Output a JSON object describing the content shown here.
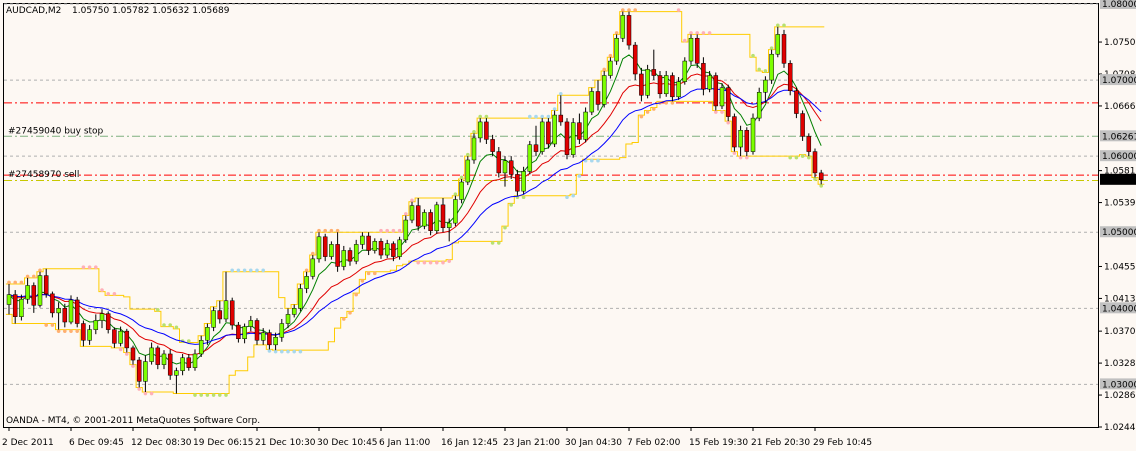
{
  "header": {
    "symbol": "AUDCAD,M2",
    "ohlc": "1.05750 1.05782 1.05632 1.05689"
  },
  "footer": {
    "copyright": "OANDA - MT4, © 2001-2011 MetaQuotes Software Corp."
  },
  "colors": {
    "background": "#fdf8f3",
    "bull": "#7cff00",
    "bear": "#e00000",
    "ma_fast": "#008000",
    "ma_mid": "#e00000",
    "ma_slow": "#0000ff",
    "channel": "#ffcc00",
    "orders": "#ff0000",
    "grid": "#b0b0b0",
    "price_tag": "#000000"
  },
  "chart_data": {
    "type": "candlestick",
    "ylim": [
      1.0244,
      1.08
    ],
    "x_ticks": [
      "2 Dec 2011",
      "6 Dec 09:45",
      "12 Dec 08:30",
      "19 Dec 06:15",
      "21 Dec 10:30",
      "30 Dec 10:45",
      "6 Jan 11:00",
      "16 Jan 12:45",
      "23 Jan 21:00",
      "30 Jan 04:30",
      "7 Feb 02:00",
      "15 Feb 19:30",
      "21 Feb 20:30",
      "29 Feb 10:45"
    ],
    "x_tick_index": [
      0,
      10,
      20,
      30,
      40,
      50,
      60,
      70,
      80,
      90,
      100,
      110,
      120,
      130
    ],
    "y_ticks": [
      "1.07500",
      "1.07080",
      "1.06660",
      "1.05810",
      "1.05390",
      "1.04550",
      "1.04130",
      "1.03700",
      "1.03280",
      "1.02860",
      "1.02440"
    ],
    "level_tags": [
      "1.08000",
      "1.07000",
      "1.06261",
      "1.06000",
      "1.05000",
      "1.04000",
      "1.03000"
    ],
    "last_price": "1.05689",
    "orders": [
      {
        "label": "#27459040 buy stop",
        "price": 1.06261
      },
      {
        "label": "#27458970 sell",
        "price": 1.05689
      }
    ],
    "horizontal_lines": [
      {
        "price": 1.067,
        "style": "dashdot",
        "color": "#ff0000"
      },
      {
        "price": 1.06261,
        "style": "dashdot",
        "color": "#7fb07f"
      },
      {
        "price": 1.0575,
        "style": "dashdot",
        "color": "#ff0000"
      },
      {
        "price": 1.0568,
        "style": "dashdot",
        "color": "#c8c800"
      }
    ],
    "grid_levels": [
      1.03,
      1.04,
      1.05,
      1.06,
      1.07,
      1.08
    ],
    "candles": [
      [
        1.0405,
        1.0432,
        1.0392,
        1.0418
      ],
      [
        1.0418,
        1.0424,
        1.038,
        1.0389
      ],
      [
        1.0389,
        1.0418,
        1.0384,
        1.0412
      ],
      [
        1.0412,
        1.044,
        1.0406,
        1.043
      ],
      [
        1.043,
        1.0434,
        1.0394,
        1.0404
      ],
      [
        1.0404,
        1.0448,
        1.0401,
        1.0443
      ],
      [
        1.0443,
        1.0452,
        1.0414,
        1.0419
      ],
      [
        1.0419,
        1.0422,
        1.0388,
        1.0394
      ],
      [
        1.0394,
        1.0408,
        1.0372,
        1.04
      ],
      [
        1.04,
        1.0406,
        1.0375,
        1.0382
      ],
      [
        1.0382,
        1.0417,
        1.0379,
        1.0411
      ],
      [
        1.0411,
        1.0415,
        1.0375,
        1.038
      ],
      [
        1.038,
        1.0384,
        1.035,
        1.0358
      ],
      [
        1.0358,
        1.0378,
        1.0352,
        1.0372
      ],
      [
        1.0372,
        1.0392,
        1.0366,
        1.0384
      ],
      [
        1.0384,
        1.0399,
        1.0374,
        1.0393
      ],
      [
        1.0393,
        1.0396,
        1.0367,
        1.0372
      ],
      [
        1.0372,
        1.0375,
        1.0348,
        1.0354
      ],
      [
        1.0354,
        1.0376,
        1.035,
        1.037
      ],
      [
        1.037,
        1.0373,
        1.0342,
        1.0348
      ],
      [
        1.0348,
        1.0351,
        1.0326,
        1.0332
      ],
      [
        1.0332,
        1.0336,
        1.0296,
        1.0304
      ],
      [
        1.0304,
        1.0338,
        1.029,
        1.033
      ],
      [
        1.033,
        1.0355,
        1.0326,
        1.0348
      ],
      [
        1.0348,
        1.0351,
        1.032,
        1.0326
      ],
      [
        1.0326,
        1.0345,
        1.032,
        1.034
      ],
      [
        1.034,
        1.0346,
        1.0306,
        1.0312
      ],
      [
        1.0312,
        1.0322,
        1.0288,
        1.0318
      ],
      [
        1.0318,
        1.034,
        1.0312,
        1.0335
      ],
      [
        1.0335,
        1.034,
        1.0318,
        1.0322
      ],
      [
        1.0322,
        1.0346,
        1.0318,
        1.034
      ],
      [
        1.034,
        1.0364,
        1.0336,
        1.0358
      ],
      [
        1.0358,
        1.038,
        1.0352,
        1.0375
      ],
      [
        1.0375,
        1.0402,
        1.037,
        1.0397
      ],
      [
        1.0397,
        1.041,
        1.038,
        1.0386
      ],
      [
        1.0386,
        1.0448,
        1.0382,
        1.041
      ],
      [
        1.041,
        1.0414,
        1.0372,
        1.0378
      ],
      [
        1.0378,
        1.0382,
        1.0355,
        1.036
      ],
      [
        1.036,
        1.038,
        1.0354,
        1.0376
      ],
      [
        1.0376,
        1.039,
        1.037,
        1.0384
      ],
      [
        1.0384,
        1.0387,
        1.0352,
        1.0358
      ],
      [
        1.0358,
        1.0374,
        1.0352,
        1.0368
      ],
      [
        1.0368,
        1.0372,
        1.0346,
        1.0352
      ],
      [
        1.0352,
        1.0368,
        1.0345,
        1.0362
      ],
      [
        1.0362,
        1.0386,
        1.0356,
        1.038
      ],
      [
        1.038,
        1.04,
        1.0374,
        1.0392
      ],
      [
        1.0392,
        1.0405,
        1.0388,
        1.04
      ],
      [
        1.04,
        1.0432,
        1.0396,
        1.0426
      ],
      [
        1.0426,
        1.0448,
        1.042,
        1.0442
      ],
      [
        1.0442,
        1.047,
        1.0438,
        1.0465
      ],
      [
        1.0465,
        1.05,
        1.046,
        1.0494
      ],
      [
        1.0494,
        1.0498,
        1.0462,
        1.0468
      ],
      [
        1.0468,
        1.0488,
        1.0464,
        1.0484
      ],
      [
        1.0484,
        1.05,
        1.0448,
        1.0455
      ],
      [
        1.0455,
        1.0482,
        1.045,
        1.0476
      ],
      [
        1.0476,
        1.048,
        1.0456,
        1.0462
      ],
      [
        1.0462,
        1.049,
        1.0458,
        1.0484
      ],
      [
        1.0484,
        1.05,
        1.0478,
        1.0495
      ],
      [
        1.0495,
        1.05,
        1.047,
        1.0476
      ],
      [
        1.0476,
        1.0492,
        1.0472,
        1.0488
      ],
      [
        1.0488,
        1.0492,
        1.0465,
        1.047
      ],
      [
        1.047,
        1.049,
        1.0466,
        1.0485
      ],
      [
        1.0485,
        1.0488,
        1.0462,
        1.0468
      ],
      [
        1.0468,
        1.0494,
        1.0464,
        1.049
      ],
      [
        1.049,
        1.0522,
        1.0486,
        1.0516
      ],
      [
        1.0516,
        1.054,
        1.0512,
        1.0535
      ],
      [
        1.0535,
        1.0545,
        1.0502,
        1.0508
      ],
      [
        1.0508,
        1.053,
        1.0504,
        1.0526
      ],
      [
        1.0526,
        1.053,
        1.0496,
        1.0502
      ],
      [
        1.0502,
        1.054,
        1.0498,
        1.0536
      ],
      [
        1.0536,
        1.0545,
        1.05,
        1.0506
      ],
      [
        1.0506,
        1.0518,
        1.0488,
        1.0512
      ],
      [
        1.0512,
        1.0548,
        1.0508,
        1.0543
      ],
      [
        1.0543,
        1.057,
        1.0538,
        1.0566
      ],
      [
        1.0566,
        1.06,
        1.0562,
        1.0595
      ],
      [
        1.0595,
        1.063,
        1.059,
        1.0624
      ],
      [
        1.0624,
        1.065,
        1.0618,
        1.0645
      ],
      [
        1.0645,
        1.065,
        1.0616,
        1.0622
      ],
      [
        1.0622,
        1.0628,
        1.06,
        1.0606
      ],
      [
        1.0606,
        1.0612,
        1.0572,
        1.0578
      ],
      [
        1.0578,
        1.06,
        1.056,
        1.0594
      ],
      [
        1.0594,
        1.06,
        1.057,
        1.0576
      ],
      [
        1.0576,
        1.0582,
        1.0548,
        1.0554
      ],
      [
        1.0554,
        1.0586,
        1.055,
        1.058
      ],
      [
        1.058,
        1.062,
        1.0576,
        1.0615
      ],
      [
        1.0615,
        1.064,
        1.06,
        1.0606
      ],
      [
        1.0606,
        1.065,
        1.0602,
        1.0645
      ],
      [
        1.0645,
        1.065,
        1.061,
        1.0616
      ],
      [
        1.0616,
        1.066,
        1.0612,
        1.0654
      ],
      [
        1.0654,
        1.068,
        1.064,
        1.0645
      ],
      [
        1.0645,
        1.065,
        1.0596,
        1.0602
      ],
      [
        1.0602,
        1.065,
        1.0598,
        1.0644
      ],
      [
        1.0644,
        1.0656,
        1.0616,
        1.0622
      ],
      [
        1.0622,
        1.0664,
        1.0618,
        1.0658
      ],
      [
        1.0658,
        1.069,
        1.0654,
        1.0685
      ],
      [
        1.0685,
        1.07,
        1.066,
        1.0668
      ],
      [
        1.0668,
        1.0712,
        1.0664,
        1.0706
      ],
      [
        1.0706,
        1.073,
        1.0702,
        1.0725
      ],
      [
        1.0725,
        1.076,
        1.072,
        1.0755
      ],
      [
        1.0755,
        1.079,
        1.075,
        1.0785
      ],
      [
        1.0785,
        1.079,
        1.074,
        1.0746
      ],
      [
        1.0746,
        1.075,
        1.07,
        1.0708
      ],
      [
        1.0708,
        1.0716,
        1.0672,
        1.068
      ],
      [
        1.068,
        1.072,
        1.0676,
        1.0714
      ],
      [
        1.0714,
        1.074,
        1.07,
        1.0706
      ],
      [
        1.0706,
        1.0712,
        1.0676,
        1.0682
      ],
      [
        1.0682,
        1.0712,
        1.0678,
        1.0706
      ],
      [
        1.0706,
        1.071,
        1.0672,
        1.0678
      ],
      [
        1.0678,
        1.0704,
        1.0674,
        1.0698
      ],
      [
        1.0698,
        1.073,
        1.0694,
        1.0725
      ],
      [
        1.0725,
        1.076,
        1.072,
        1.0755
      ],
      [
        1.0755,
        1.076,
        1.0716,
        1.0722
      ],
      [
        1.0722,
        1.073,
        1.068,
        1.0688
      ],
      [
        1.0688,
        1.0712,
        1.0684,
        1.0706
      ],
      [
        1.0706,
        1.071,
        1.066,
        1.0666
      ],
      [
        1.0666,
        1.0696,
        1.0662,
        1.069
      ],
      [
        1.069,
        1.0694,
        1.0646,
        1.0652
      ],
      [
        1.0652,
        1.0656,
        1.0606,
        1.0612
      ],
      [
        1.0612,
        1.064,
        1.06,
        1.0634
      ],
      [
        1.0634,
        1.0638,
        1.06,
        1.0606
      ],
      [
        1.0606,
        1.0656,
        1.0602,
        1.065
      ],
      [
        1.065,
        1.069,
        1.0646,
        1.0684
      ],
      [
        1.0684,
        1.0705,
        1.067,
        1.07
      ],
      [
        1.07,
        1.074,
        1.0695,
        1.0734
      ],
      [
        1.0734,
        1.077,
        1.073,
        1.076
      ],
      [
        1.076,
        1.0766,
        1.0716,
        1.0722
      ],
      [
        1.0722,
        1.0726,
        1.068,
        1.0686
      ],
      [
        1.0686,
        1.069,
        1.065,
        1.0656
      ],
      [
        1.0656,
        1.066,
        1.062,
        1.0626
      ],
      [
        1.0626,
        1.063,
        1.06,
        1.0606
      ],
      [
        1.0606,
        1.061,
        1.0572,
        1.0578
      ],
      [
        1.0578,
        1.0582,
        1.0563,
        1.0569
      ]
    ]
  }
}
